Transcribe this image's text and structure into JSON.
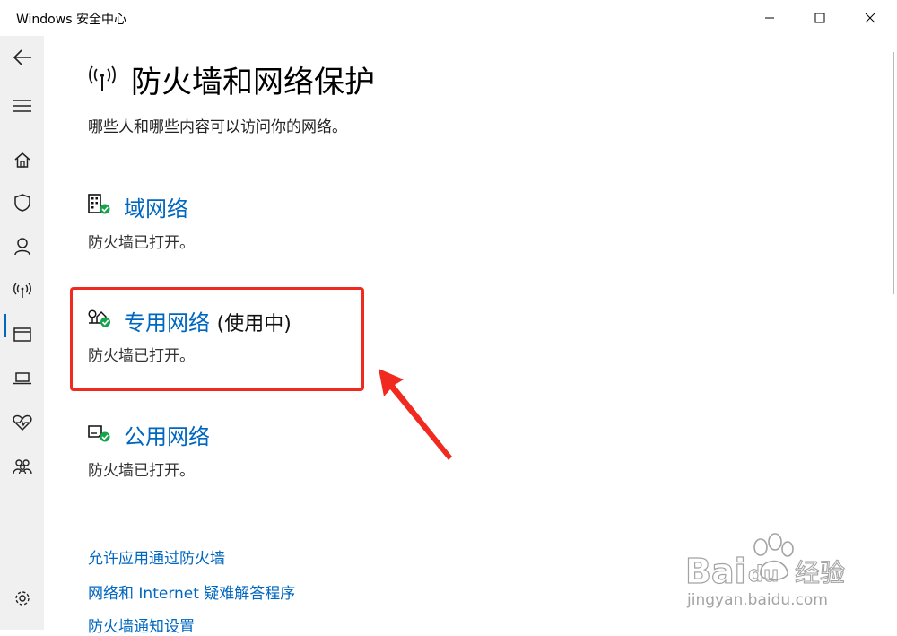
{
  "window": {
    "title": "Windows 安全中心"
  },
  "sidebar": {
    "items": [
      {
        "icon": "back-arrow-icon"
      },
      {
        "icon": "hamburger-menu-icon"
      },
      {
        "icon": "home-icon"
      },
      {
        "icon": "shield-icon"
      },
      {
        "icon": "account-person-icon"
      },
      {
        "icon": "firewall-antenna-icon",
        "selected": true
      },
      {
        "icon": "app-browser-window-icon"
      },
      {
        "icon": "device-laptop-icon"
      },
      {
        "icon": "health-heart-icon"
      },
      {
        "icon": "family-icon"
      },
      {
        "icon": "settings-gear-icon"
      }
    ]
  },
  "page": {
    "title": "防火墙和网络保护",
    "subtitle": "哪些人和哪些内容可以访问你的网络。"
  },
  "networks": [
    {
      "name": "域网络",
      "badge": "",
      "status": "防火墙已打开。",
      "icon": "domain-network-icon"
    },
    {
      "name": "专用网络",
      "badge": "(使用中)",
      "status": "防火墙已打开。",
      "icon": "private-network-icon"
    },
    {
      "name": "公用网络",
      "badge": "",
      "status": "防火墙已打开。",
      "icon": "public-network-icon"
    }
  ],
  "links": [
    "允许应用通过防火墙",
    "网络和 Internet 疑难解答程序",
    "防火墙通知设置"
  ],
  "colors": {
    "accent": "#0067c0",
    "status_ok": "#16a34a",
    "annotation": "#f02a1e",
    "sidebar_bg": "#f0f0f0"
  },
  "watermark": {
    "brand": "Baidu",
    "brand_cn": "经验",
    "url": "jingyan.baidu.com"
  }
}
